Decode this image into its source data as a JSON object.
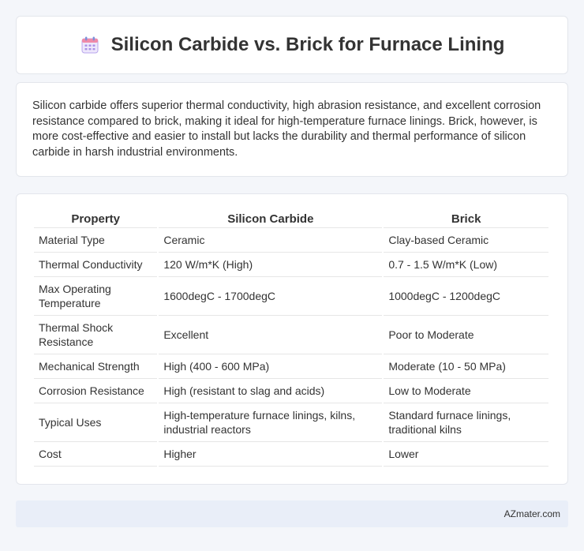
{
  "header": {
    "icon": "calendar-icon",
    "title": "Silicon Carbide vs. Brick for Furnace Lining"
  },
  "summary": {
    "text": "Silicon carbide offers superior thermal conductivity, high abrasion resistance, and excellent corrosion resistance compared to brick, making it ideal for high-temperature furnace linings. Brick, however, is more cost-effective and easier to install but lacks the durability and thermal performance of silicon carbide in harsh industrial environments."
  },
  "table": {
    "headers": [
      "Property",
      "Silicon Carbide",
      "Brick"
    ],
    "rows": [
      [
        "Material Type",
        "Ceramic",
        "Clay-based Ceramic"
      ],
      [
        "Thermal Conductivity",
        "120 W/m*K (High)",
        "0.7 - 1.5 W/m*K (Low)"
      ],
      [
        "Max Operating Temperature",
        "1600degC - 1700degC",
        "1000degC - 1200degC"
      ],
      [
        "Thermal Shock Resistance",
        "Excellent",
        "Poor to Moderate"
      ],
      [
        "Mechanical Strength",
        "High (400 - 600 MPa)",
        "Moderate (10 - 50 MPa)"
      ],
      [
        "Corrosion Resistance",
        "High (resistant to slag and acids)",
        "Low to Moderate"
      ],
      [
        "Typical Uses",
        "High-temperature furnace linings, kilns, industrial reactors",
        "Standard furnace linings, traditional kilns"
      ],
      [
        "Cost",
        "Higher",
        "Lower"
      ]
    ]
  },
  "footer": {
    "text": "AZmater.com"
  }
}
